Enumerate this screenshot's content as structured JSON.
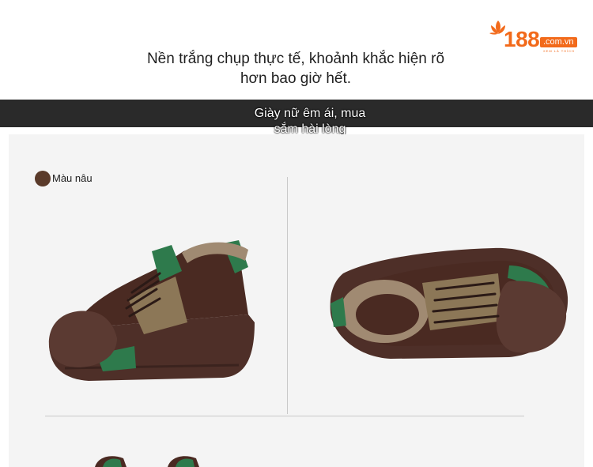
{
  "header": {
    "headline_line1": "Nền trắng chụp thực tế, khoảnh khắc hiện rõ",
    "headline_line2": "hơn bao giờ hết."
  },
  "logo": {
    "number": "188",
    "domain": ".com.vn",
    "slogan": "XEM LÀ THÍCH",
    "brand_color": "#f26a1b"
  },
  "banner": {
    "caption_line1": "Giày nữ êm ái, mua",
    "caption_line2": "sắm hài lòng",
    "background_color": "#2a2a2a"
  },
  "product": {
    "color_option": {
      "label": "Màu nâu",
      "swatch_color": "#5a3a2a"
    },
    "images": [
      {
        "icon": "shoe-side-view-icon"
      },
      {
        "icon": "shoe-back-view-icon"
      },
      {
        "icon": "shoe-pair-partial-icon"
      }
    ],
    "colors": {
      "suede_brown": "#4a2a22",
      "rubber_toe": "#5b3a32",
      "green_accent": "#2e7a4c",
      "tan_panel": "#8c7757",
      "fur_lining": "#a08a72"
    }
  }
}
